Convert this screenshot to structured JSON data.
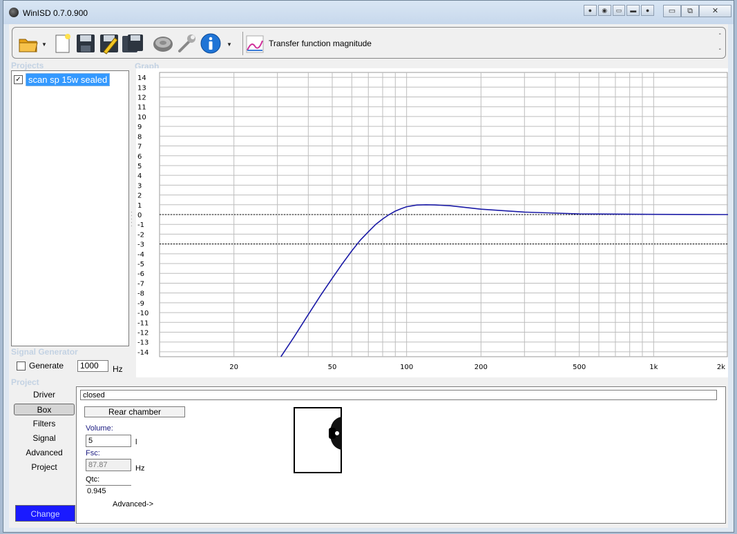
{
  "window": {
    "title": "WinISD 0.7.0.900",
    "minimize": "▭",
    "restore": "⧉",
    "close": "✕"
  },
  "toolbar": {
    "graph_selector_label": "Transfer function magnitude",
    "icons": [
      "open-folder-icon",
      "new-document-icon",
      "save-icon",
      "save-as-icon",
      "save-all-icon",
      "driver-icon",
      "wrench-icon",
      "info-icon",
      "graph-icon"
    ]
  },
  "projects": {
    "heading": "Projects",
    "items": [
      {
        "label": "scan sp 15w sealed",
        "checked": true
      }
    ]
  },
  "graph": {
    "heading": "Graph"
  },
  "signal_generator": {
    "heading": "Signal Generator",
    "generate_label": "Generate",
    "frequency": "1000",
    "unit": "Hz"
  },
  "project": {
    "heading": "Project",
    "nav": [
      "Driver",
      "Box",
      "Filters",
      "Signal",
      "Advanced",
      "Project"
    ],
    "active_nav": "Box",
    "change_label": "Change"
  },
  "box": {
    "type": "closed",
    "rear_chamber_label": "Rear chamber",
    "volume_label": "Volume:",
    "volume": "5",
    "volume_unit": "l",
    "fsc_label": "Fsc:",
    "fsc": "87.87",
    "fsc_unit": "Hz",
    "qtc_label": "Qtc:",
    "qtc": "0.945",
    "advanced_label": "Advanced->"
  },
  "chart_data": {
    "type": "line",
    "x_scale": "log",
    "xlim": [
      10,
      2000
    ],
    "ylim": [
      -14.5,
      14.5
    ],
    "x_ticks": [
      20,
      50,
      100,
      200,
      500,
      1000,
      2000
    ],
    "x_tick_labels": [
      "20",
      "50",
      "100",
      "200",
      "500",
      "1k",
      "2k"
    ],
    "y_ticks": [
      14,
      13,
      12,
      11,
      10,
      9,
      8,
      7,
      6,
      5,
      4,
      3,
      2,
      1,
      0,
      -1,
      -2,
      -3,
      -4,
      -5,
      -6,
      -7,
      -8,
      -9,
      -10,
      -11,
      -12,
      -13,
      -14
    ],
    "reference_lines": [
      0,
      -3
    ],
    "grid": true,
    "series": [
      {
        "color": "#1a1aa6",
        "x": [
          31,
          35,
          40,
          45,
          50,
          55,
          60,
          65,
          70,
          75,
          80,
          85,
          90,
          95,
          100,
          110,
          120,
          130,
          150,
          200,
          300,
          500,
          1000,
          2000
        ],
        "y": [
          -14.5,
          -12.5,
          -10.2,
          -8.2,
          -6.5,
          -5.0,
          -3.7,
          -2.6,
          -1.75,
          -1.0,
          -0.45,
          0.0,
          0.35,
          0.6,
          0.8,
          0.97,
          1.0,
          0.98,
          0.9,
          0.55,
          0.25,
          0.07,
          0.02,
          0.0
        ]
      }
    ]
  }
}
